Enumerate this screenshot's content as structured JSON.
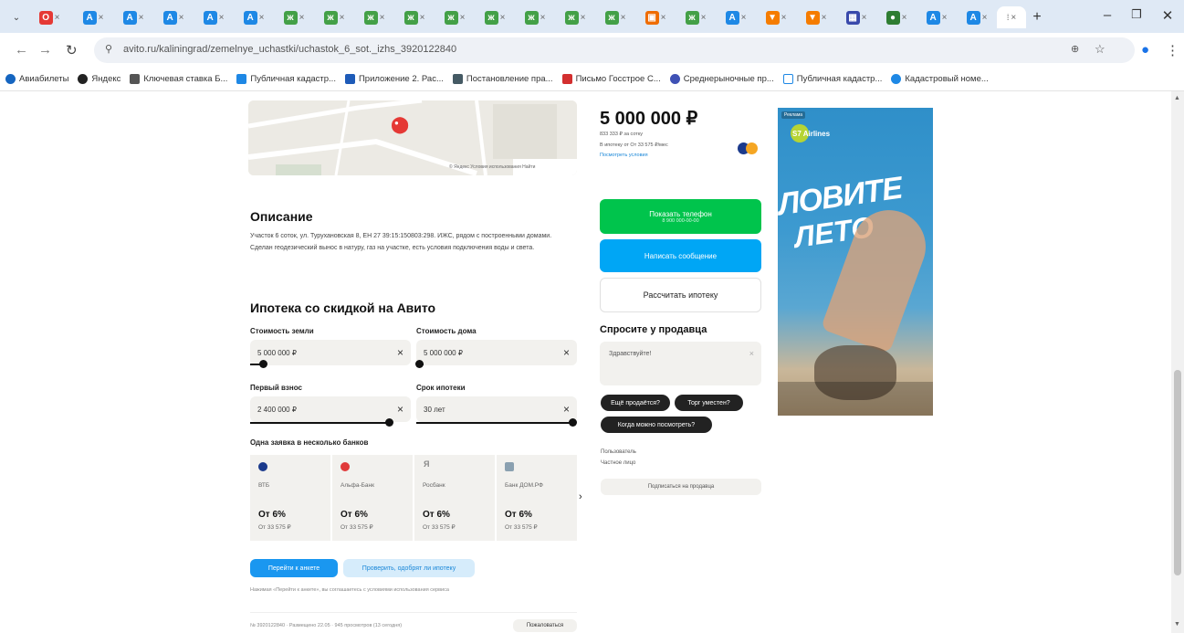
{
  "browser": {
    "url": "avito.ru/kaliningrad/zemelnye_uchastki/uchastok_6_sot._izhs_3920122840",
    "bookmarks": [
      "Авиабилеты",
      "Яндекс",
      "Ключевая ставка Б...",
      "Публичная кадастр...",
      "Приложение 2. Рас...",
      "Постановление пра...",
      "Письмо Госстрое С...",
      "Среднерыночные пр...",
      "Публичная кадастр...",
      "Кадастровый номе..."
    ]
  },
  "listing": {
    "price": "5 000 000 ₽",
    "price_per_unit": "833 333 ₽ за сотку",
    "mortgage_from": "В ипотеку от От 33 575 ₽/мес",
    "mortgage_link": "Посмотреть условия",
    "map_copyright": "© Яндекс Условия использования Найти"
  },
  "description": {
    "title": "Описание",
    "text": "Участок 6 соток, ул. Турухановская 8, ЕН 27 39:15:150803:298. ИЖС, рядом с построенными домами. Сделан геодезический вынос в натуру, газ на участке, есть условия подключения воды и света."
  },
  "mortgage": {
    "title": "Ипотека со скидкой на Авито",
    "land_cost_label": "Стоимость земли",
    "land_cost_value": "5 000 000 ₽",
    "house_cost_label": "Стоимость дома",
    "house_cost_value": "5 000 000 ₽",
    "down_payment_label": "Первый взнос",
    "down_payment_value": "2 400 000 ₽",
    "term_label": "Срок ипотеки",
    "term_value": "30 лет",
    "banks_title": "Одна заявка в несколько банков",
    "banks": [
      {
        "name": "ВТБ",
        "rate": "От 6%",
        "payment": "От 33 575 ₽",
        "color": "#1b3a8c"
      },
      {
        "name": "Альфа-Банк",
        "rate": "От 6%",
        "payment": "От 33 575 ₽",
        "color": "#e03a3a"
      },
      {
        "name": "Росбанк",
        "rate": "От 6%",
        "payment": "От 33 575 ₽",
        "color": "#888888"
      },
      {
        "name": "Банк ДОМ.РФ",
        "rate": "От 6%",
        "payment": "От 33 575 ₽",
        "color": "#8aa0b0"
      }
    ],
    "apply_button": "Перейти к анкете",
    "check_button": "Проверить, одобрят ли ипотеку",
    "disclaimer": "Нажимая «Перейти к анкете», вы соглашаетесь с условиями использования сервиса",
    "footer_note": "№ 3920122840 · Размещено 22.05 · 945 просмотров (13 сегодня)",
    "report_button": "Пожаловаться"
  },
  "sidebar": {
    "show_phone": "Показать телефон",
    "show_phone_sub": "8 900 000-00-00",
    "write_message": "Написать сообщение",
    "calc_mortgage": "Рассчитать ипотеку",
    "ask_title": "Спросите у продавца",
    "ask_placeholder": "Здравствуйте!",
    "chips": [
      "Ещё продаётся?",
      "Торг уместен?",
      "Когда можно посмотреть?"
    ],
    "seller_type": "Пользователь",
    "seller_name": "Частное лицо",
    "subscribe": "Подписаться на продавца"
  },
  "ad": {
    "label": "Реклама",
    "brand": "S7 Airlines",
    "headline_1": "ЛОВИТЕ",
    "headline_2": "ЛЕТО"
  }
}
